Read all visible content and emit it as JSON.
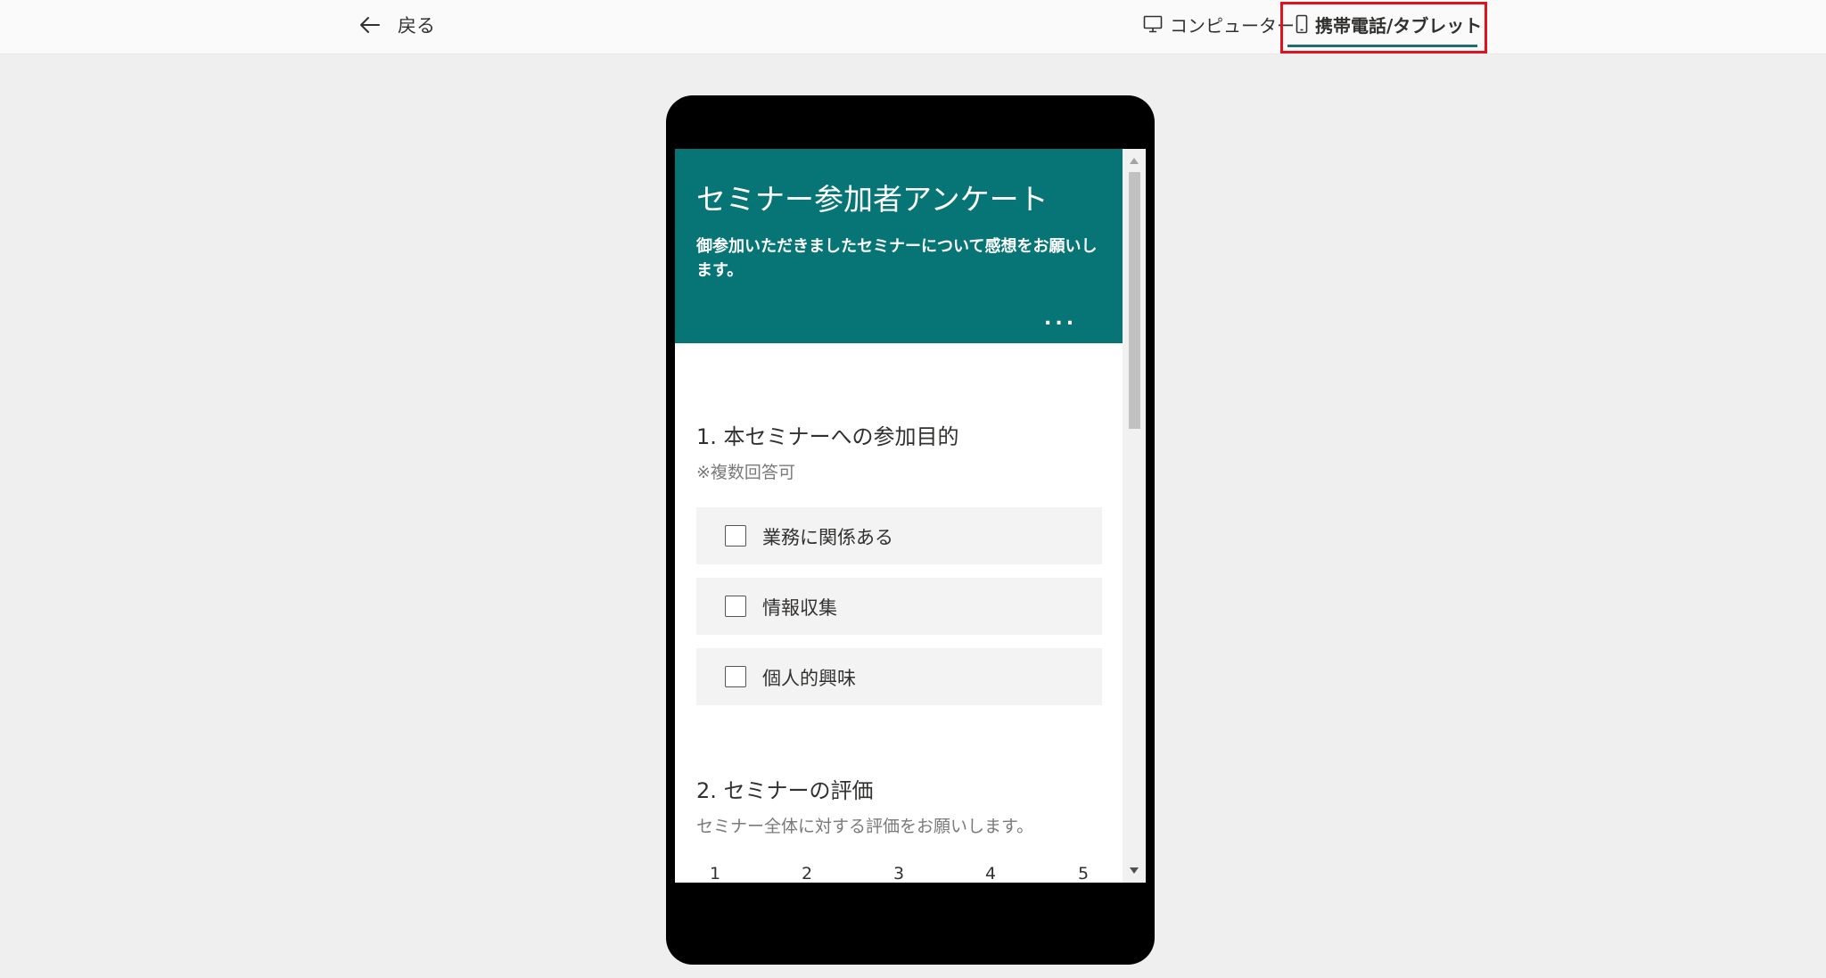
{
  "topbar": {
    "back_label": "戻る",
    "view_computer_label": "コンピューター",
    "view_mobile_label": "携帯電話/タブレット",
    "selected_view": "携帯電話/タブレット",
    "highlight_color": "#e0121e"
  },
  "form": {
    "header_color": "#077575",
    "title": "セミナー参加者アンケート",
    "description": "御参加いただきましたセミナーについて感想をお願いします。",
    "more_label": "...",
    "questions": [
      {
        "title": "1. 本セミナーへの参加目的",
        "subtitle": "※複数回答可",
        "options": [
          "業務に関係ある",
          "情報収集",
          "個人的興味"
        ]
      },
      {
        "title": "2. セミナーの評価",
        "subtitle": "セミナー全体に対する評価をお願いします。",
        "ratings": [
          "1",
          "2",
          "3",
          "4",
          "5"
        ]
      }
    ]
  }
}
